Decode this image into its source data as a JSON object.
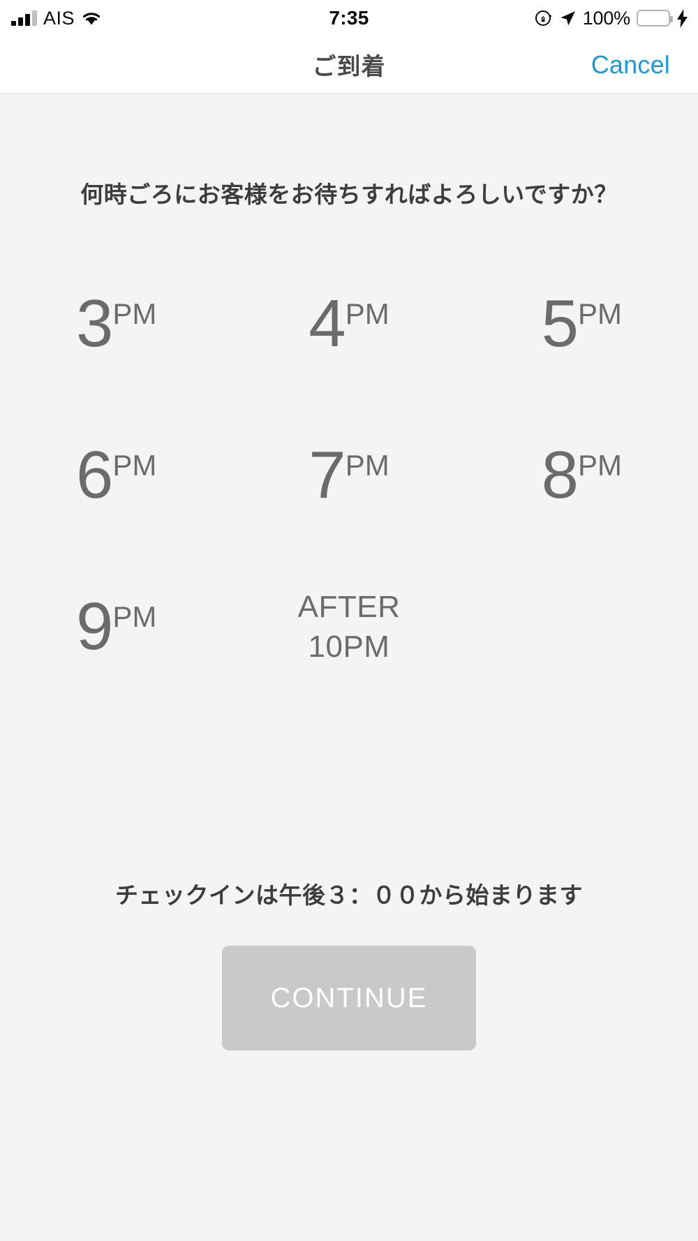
{
  "status_bar": {
    "carrier": "AIS",
    "time": "7:35",
    "battery_percent": "100%",
    "signal_bars_filled": 3,
    "signal_bars_total": 4,
    "icons": {
      "wifi": "wifi-icon",
      "rotation_lock": "rotation-lock-icon",
      "location": "location-arrow-icon",
      "battery": "battery-icon",
      "charging": "lightning-bolt-icon"
    },
    "colors": {
      "battery_fill": "#4cd565",
      "bar_active": "#0a0a0a",
      "bar_inactive": "#c0c0c0"
    }
  },
  "nav": {
    "title": "ご到着",
    "cancel_label": "Cancel",
    "accent_color": "#1f9ad6"
  },
  "main": {
    "question": "何時ごろにお客様をお待ちすればよろしいですか？",
    "time_options": [
      {
        "hour": "3",
        "suffix": "PM",
        "multiline": null
      },
      {
        "hour": "4",
        "suffix": "PM",
        "multiline": null
      },
      {
        "hour": "5",
        "suffix": "PM",
        "multiline": null
      },
      {
        "hour": "6",
        "suffix": "PM",
        "multiline": null
      },
      {
        "hour": "7",
        "suffix": "PM",
        "multiline": null
      },
      {
        "hour": "8",
        "suffix": "PM",
        "multiline": null
      },
      {
        "hour": "9",
        "suffix": "PM",
        "multiline": null
      },
      {
        "hour": null,
        "suffix": null,
        "multiline": "AFTER\n10PM"
      },
      {
        "hour": null,
        "suffix": null,
        "multiline": null
      }
    ],
    "footer_note": "チェックインは午後３：００から始まります",
    "continue_label": "CONTINUE",
    "continue_color": "#c9c9c9"
  }
}
